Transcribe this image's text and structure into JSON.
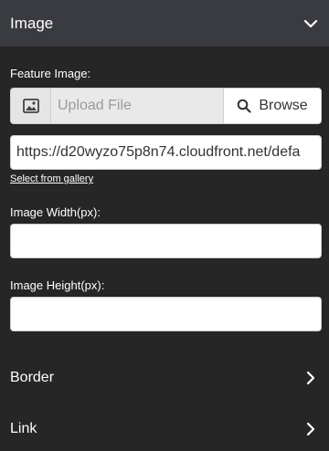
{
  "header": {
    "title": "Image",
    "chevron_icon": "chevron-down-icon"
  },
  "feature_image": {
    "label": "Feature Image:",
    "upload_icon": "image-icon",
    "upload_placeholder": "Upload File",
    "browse_label": "Browse",
    "browse_icon": "search-icon"
  },
  "url_input": {
    "value": "https://d20wyzo75p8n74.cloudfront.net/defa"
  },
  "gallery_link": "Select from gallery",
  "image_width": {
    "label": "Image Width(px):",
    "value": ""
  },
  "image_height": {
    "label": "Image Height(px):",
    "value": ""
  },
  "sections": [
    {
      "label": "Border",
      "icon": "chevron-right-icon"
    },
    {
      "label": "Link",
      "icon": "chevron-right-icon"
    }
  ],
  "colors": {
    "background": "#262626",
    "header": "#3a3b40",
    "input": "#ffffff",
    "upload_bg": "#e9e9e9"
  }
}
